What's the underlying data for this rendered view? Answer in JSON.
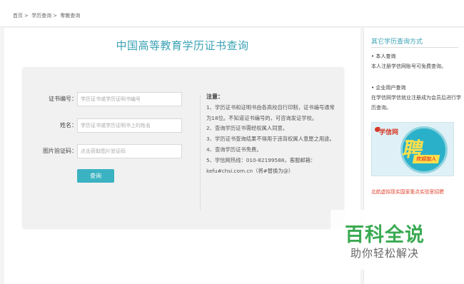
{
  "breadcrumb": {
    "items": [
      "首页",
      "学历查询",
      "零散查询"
    ],
    "separator": ">"
  },
  "main": {
    "title": "中国高等教育学历证书查询",
    "form": {
      "cert_label": "证书编号：",
      "cert_placeholder": "学历证书或学历证明书编号",
      "name_label": "姓名：",
      "name_placeholder": "学历证书或学历证明书上的姓名",
      "captcha_label": "图片验证码：",
      "captcha_placeholder": "点击获取图片验证码",
      "submit_label": "查询"
    },
    "notes": {
      "title": "注意：",
      "items": [
        "1、学历证书和证明书由各高校自行印制，证书编号通常为18位。不知道证书编号的，可咨询发证学校。",
        "2、查询学历证书需经权属人同意。",
        "3、学历证书查询结果不得用于违背权属人意愿之用途。",
        "4、查询学历证书免费。",
        "5、学信网热线：010-82199588，客服邮箱：kefu#chsi.com.cn（将#替换为@）"
      ]
    }
  },
  "sidebar": {
    "title": "其它学历查询方式",
    "sections": [
      {
        "heading": "• 本人查询",
        "text": "本人注册学信网账号可免费查询。"
      },
      {
        "heading": "• 企业用户查询",
        "text": "在学信网学信就业注册成为会员后进行学历查询。"
      }
    ],
    "banner": {
      "logo_text": "学信网",
      "big_char": "聘",
      "join_text": "欢迎加入"
    },
    "red_link": "北航虚拟现实国家重点实验室招聘"
  },
  "watermark": {
    "main": "百科全说",
    "sub": "助你轻松解决"
  }
}
